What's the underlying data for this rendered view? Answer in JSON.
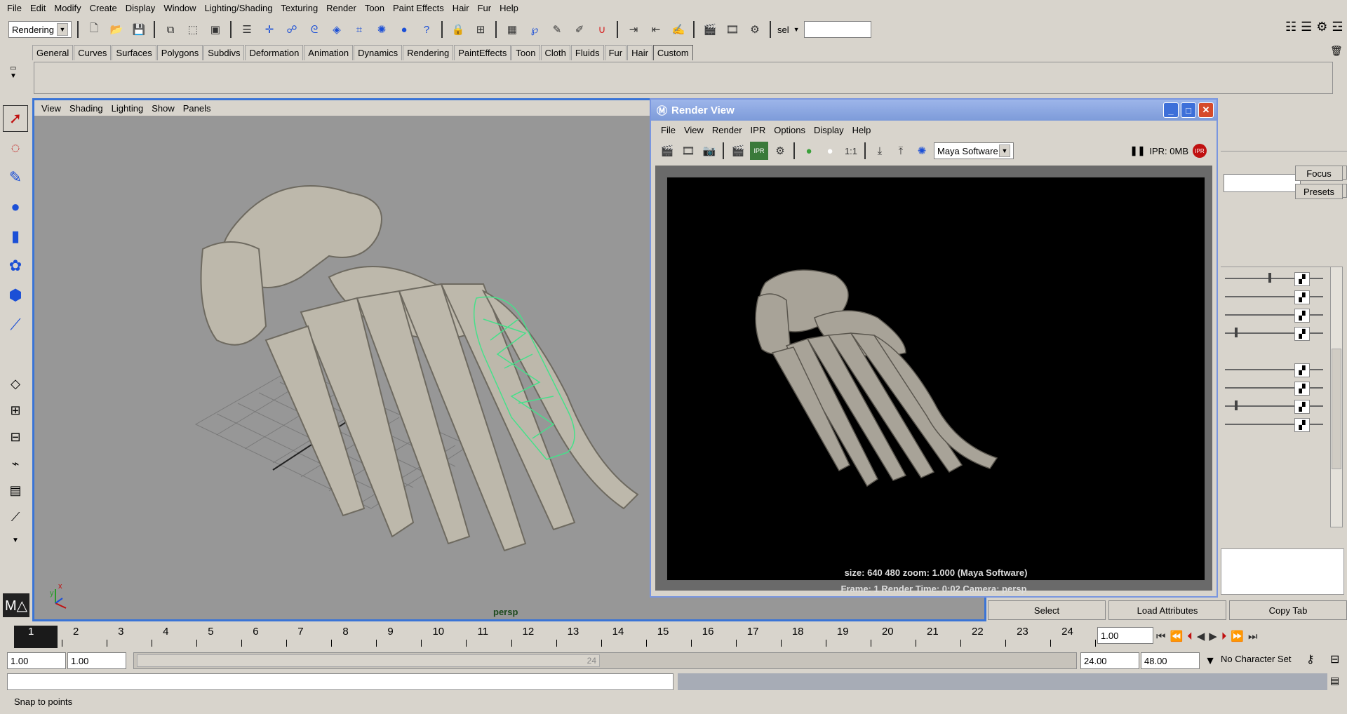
{
  "menus": [
    "File",
    "Edit",
    "Modify",
    "Create",
    "Display",
    "Window",
    "Lighting/Shading",
    "Texturing",
    "Render",
    "Toon",
    "Hair",
    "Fur",
    "Paint Effects",
    "Help"
  ],
  "menus_fixed": [
    "File",
    "Edit",
    "Modify",
    "Create",
    "Display",
    "Window",
    "Lighting/Shading",
    "Texturing",
    "Render",
    "Toon",
    "Paint Effects",
    "Hair",
    "Fur",
    "Help"
  ],
  "statusline": {
    "menuset": "Rendering",
    "sel_label": "sel",
    "sel_value": ""
  },
  "shelf_tabs": [
    "General",
    "Curves",
    "Surfaces",
    "Polygons",
    "Subdivs",
    "Deformation",
    "Animation",
    "Dynamics",
    "Rendering",
    "PaintEffects",
    "Toon",
    "Cloth",
    "Fluids",
    "Fur",
    "Hair",
    "Custom"
  ],
  "viewport": {
    "menus": [
      "View",
      "Shading",
      "Lighting",
      "Show",
      "Panels"
    ],
    "camera_label": "persp",
    "axis_x": "x",
    "axis_y": "y"
  },
  "render_view": {
    "title": "Render View",
    "menus": [
      "File",
      "View",
      "Render",
      "IPR",
      "Options",
      "Display",
      "Help"
    ],
    "renderer": "Maya Software",
    "ratio_label": "1:1",
    "ipr_status": "IPR: 0MB",
    "info_line1": "size:  640  480 zoom: 1.000        (Maya Software)",
    "info_line2": "Frame: 1      Render Time: 0:02      Camera: persp"
  },
  "attribute_editor": {
    "focus": "Focus",
    "presets": "Presets",
    "select": "Select",
    "load_attributes": "Load Attributes",
    "copy_tab": "Copy Tab"
  },
  "timeslider": {
    "ticks": [
      "1",
      "2",
      "3",
      "4",
      "5",
      "6",
      "7",
      "8",
      "9",
      "10",
      "11",
      "12",
      "13",
      "14",
      "15",
      "16",
      "17",
      "18",
      "19",
      "20",
      "21",
      "22",
      "23",
      "24"
    ],
    "current_frame": "1.00"
  },
  "range": {
    "start": "1.00",
    "playback_start": "1.00",
    "playback_end": "24.00",
    "end": "48.00",
    "range_end_label": "24",
    "character_set": "No Character Set"
  },
  "helpline": "Snap to points",
  "colors": {
    "viewport_border": "#3a74d6",
    "titlebar": "#7d9bd9",
    "wireframe": "#46e08a"
  }
}
